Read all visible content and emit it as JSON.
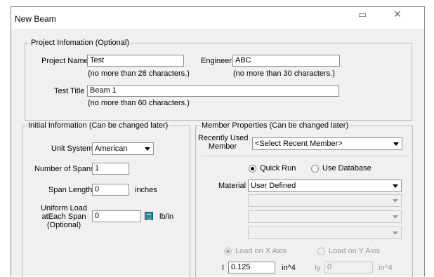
{
  "window": {
    "title": "New Beam",
    "restore_icon": "restore-window-icon",
    "close_icon": "close-icon",
    "close_glyph": "✕",
    "restore_glyph": "▭"
  },
  "project_info": {
    "legend": "Project Infomation (Optional)",
    "project_name_label": "Project Name",
    "project_name_value": "Test",
    "project_name_hint": "(no more than 28 characters.)",
    "engineer_label": "Engineer",
    "engineer_value": "ABC",
    "engineer_hint": "(no more than 30 characters.)",
    "test_title_label": "Test Title",
    "test_title_value": "Beam 1",
    "test_title_hint": "(no more than 60 characters.)"
  },
  "initial_info": {
    "legend": "Initial Information  (Can be changed later)",
    "unit_system_label": "Unit System",
    "unit_system_value": "American",
    "num_spans_label": "Number of Spans",
    "num_spans_value": "1",
    "span_length_label": "Span Length",
    "span_length_value": "0",
    "span_length_unit": "inches",
    "uniform_load_label_1": "Uniform Load",
    "uniform_load_label_2": "atEach Span",
    "uniform_load_label_3": "(Optional)",
    "uniform_load_value": "0",
    "uniform_load_unit": "lb/in",
    "calculator_icon": "calculator-icon"
  },
  "member_props": {
    "legend": "Member Properties  (Can be changed later)",
    "recently_used_label_1": "Recently Used",
    "recently_used_label_2": "Member",
    "recently_used_value": "<Select Recent Member>",
    "quick_run_label": "Quick Run",
    "use_database_label": "Use Database",
    "material_label": "Material",
    "material_value": "User Defined",
    "load_x_label": "Load on X Axis",
    "load_y_label": "Load on Y Axis",
    "i_label": "I",
    "i_value": "0.125",
    "i_unit": "in^4",
    "iy_label": "Iy",
    "iy_value": "0",
    "iy_unit": "in^4"
  }
}
